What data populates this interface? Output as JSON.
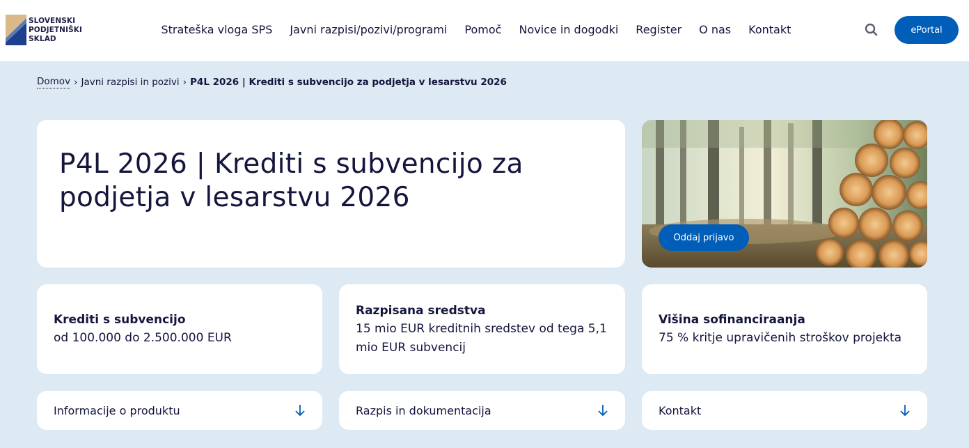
{
  "brand": {
    "logo_lines": [
      "SLOVENSKI",
      "PODJETNIŠKI",
      "SKLAD"
    ],
    "colors": {
      "gold": "#d8b987",
      "navy": "#1c3f8f",
      "accent": "#005eb8"
    }
  },
  "nav": {
    "items": [
      "Strateška vloga SPS",
      "Javni razpisi/pozivi/programi",
      "Pomoč",
      "Novice in dogodki",
      "Register",
      "O nas",
      "Kontakt"
    ],
    "search_icon": "search-icon",
    "eportal_label": "ePortal"
  },
  "breadcrumb": {
    "home": "Domov",
    "separator": "›",
    "parent": "Javni razpisi in pozivi",
    "current": "P4L 2026 | Krediti s subvencijo za podjetja v lesarstvu 2026"
  },
  "hero": {
    "title": "P4L 2026 | Krediti s subvencijo za podjetja v lesarstvu 2026",
    "image_subject": "forest with stacked logs",
    "apply_label": "Oddaj prijavo"
  },
  "info_cards": [
    {
      "label": "Krediti s subvencijo",
      "value": "od 100.000 do 2.500.000 EUR"
    },
    {
      "label": "Razpisana sredstva",
      "value": "15 mio EUR kreditnih sredstev od tega 5,1 mio EUR subvencij"
    },
    {
      "label": "Višina sofinanciraanja",
      "value": "75 % kritje upravičenih stroškov projekta"
    }
  ],
  "accordions": [
    {
      "label": "Informacije o produktu",
      "icon": "arrow-down-icon"
    },
    {
      "label": "Razpis in dokumentacija",
      "icon": "arrow-down-icon"
    },
    {
      "label": "Kontakt",
      "icon": "arrow-down-icon"
    }
  ]
}
